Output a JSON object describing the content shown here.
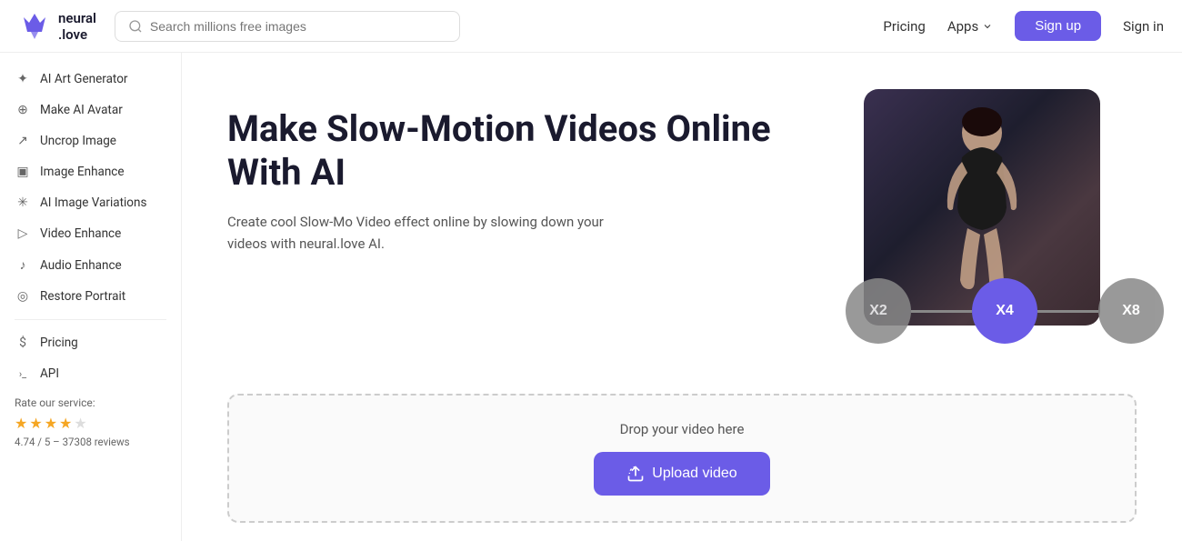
{
  "logo": {
    "text": "neural\n.love"
  },
  "search": {
    "placeholder": "Search millions free images"
  },
  "header": {
    "pricing_label": "Pricing",
    "apps_label": "Apps",
    "signup_label": "Sign up",
    "signin_label": "Sign in"
  },
  "sidebar": {
    "items": [
      {
        "id": "ai-art-generator",
        "label": "AI Art Generator",
        "icon": "✦"
      },
      {
        "id": "make-ai-avatar",
        "label": "Make AI Avatar",
        "icon": "⊕"
      },
      {
        "id": "uncrop-image",
        "label": "Uncrop Image",
        "icon": "↗"
      },
      {
        "id": "image-enhance",
        "label": "Image Enhance",
        "icon": "▣"
      },
      {
        "id": "ai-image-variations",
        "label": "AI Image Variations",
        "icon": "✳"
      },
      {
        "id": "video-enhance",
        "label": "Video Enhance",
        "icon": "▷"
      },
      {
        "id": "audio-enhance",
        "label": "Audio Enhance",
        "icon": "♪"
      },
      {
        "id": "restore-portrait",
        "label": "Restore Portrait",
        "icon": "◎"
      }
    ],
    "bottom_items": [
      {
        "id": "pricing",
        "label": "Pricing",
        "icon": "$"
      },
      {
        "id": "api",
        "label": "API",
        "icon": ">_"
      }
    ],
    "rate_label": "Rate our service:",
    "stars": [
      true,
      true,
      true,
      true,
      false
    ],
    "rating": "4.74 / 5 – 37308 reviews"
  },
  "hero": {
    "title": "Make Slow-Motion Videos Online With AI",
    "description": "Create cool Slow-Mo Video effect online by slowing down your videos with neural.love AI."
  },
  "speed_options": [
    {
      "label": "X2",
      "active": false
    },
    {
      "label": "X4",
      "active": true
    },
    {
      "label": "X8",
      "active": false
    }
  ],
  "upload": {
    "drop_text": "Drop your video here",
    "button_label": "Upload video"
  }
}
